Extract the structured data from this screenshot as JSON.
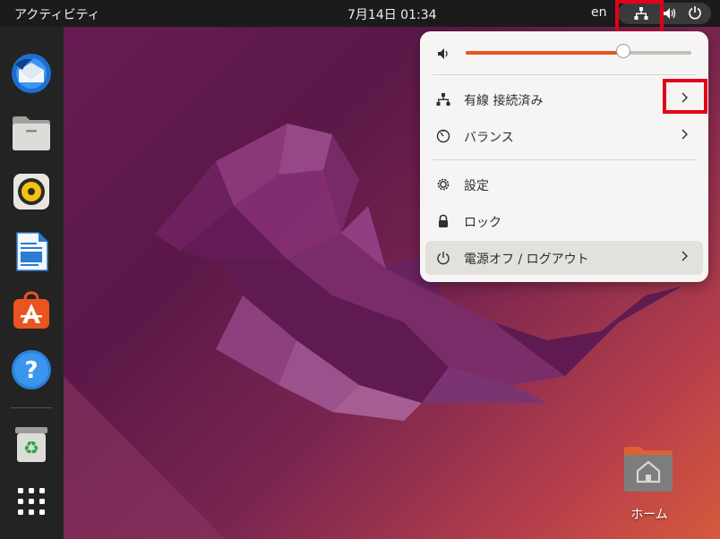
{
  "topbar": {
    "activities": "アクティビティ",
    "clock": "7月14日  01:34",
    "language": "en",
    "tray_icons": [
      "network-wired-icon",
      "volume-icon",
      "power-icon"
    ]
  },
  "dock": {
    "apps": [
      "thunderbird",
      "files",
      "rhythmbox",
      "libreoffice-writer",
      "ubuntu-software",
      "help",
      "trash",
      "show-applications"
    ]
  },
  "desktop": {
    "home_label": "ホーム"
  },
  "menu": {
    "volume_percent": 70,
    "items": [
      {
        "label": "有線 接続済み",
        "icon": "network-wired-icon",
        "submenu": true
      },
      {
        "label": "バランス",
        "icon": "power-profile-icon",
        "submenu": true
      },
      {
        "label": "設定",
        "icon": "settings-gear-icon",
        "submenu": false
      },
      {
        "label": "ロック",
        "icon": "lock-icon",
        "submenu": false
      },
      {
        "label": "電源オフ / ログアウト",
        "icon": "power-icon",
        "submenu": true
      }
    ]
  },
  "colors": {
    "accent": "#e95420",
    "highlight_box": "#e3001b",
    "topbar": "#1b1b1b",
    "dock": "#232323"
  }
}
